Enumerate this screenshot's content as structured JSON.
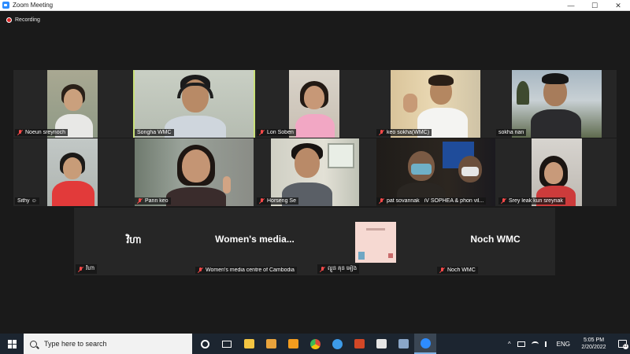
{
  "window": {
    "title": "Zoom Meeting",
    "controls": {
      "minimize": "—",
      "maximize": "☐",
      "close": "✕"
    }
  },
  "recording": {
    "label": "Recording"
  },
  "participants": [
    {
      "name": "Noeun sreynoch"
    },
    {
      "name": "Songha WMC",
      "speaking": true
    },
    {
      "name": "Lon Soben"
    },
    {
      "name": "keo sokha(WMC)"
    },
    {
      "name": "sokha nan"
    },
    {
      "name": "Sithy",
      "emoji": "☺"
    },
    {
      "name": "Pann keo"
    },
    {
      "name": "Horseng Se"
    },
    {
      "name": "pat sovannak"
    },
    {
      "name": "iV SOPHEA & phon vil..."
    },
    {
      "name": "Srey leak kun sreynak"
    },
    {
      "name": "វិហា",
      "display": "វិហា"
    },
    {
      "name": "Women's media centre of Cambodia",
      "display": "Women's  media..."
    },
    {
      "name": "ល្ងួន គុន អៀង"
    },
    {
      "name": "Noch WMC",
      "display": "Noch WMC"
    }
  ],
  "taskbar": {
    "search_placeholder": "Type here to search",
    "tray": {
      "chevron": "^",
      "language": "ENG"
    },
    "clock": {
      "time": "5:05 PM",
      "date": "2/20/2022"
    },
    "notifications": "11",
    "apps": [
      {
        "name": "task-view",
        "color": "#ffffff"
      },
      {
        "name": "file-explorer",
        "color": "#f4c542"
      },
      {
        "name": "media-player",
        "color": "#e8a33c"
      },
      {
        "name": "outlook",
        "color": "#f39c1e"
      },
      {
        "name": "chrome",
        "color": "#dd4b39"
      },
      {
        "name": "edge",
        "color": "#3d9be9"
      },
      {
        "name": "powerpoint",
        "color": "#d24726"
      },
      {
        "name": "clapper",
        "color": "#e6e6e6"
      },
      {
        "name": "network-drive",
        "color": "#8aa6c8"
      },
      {
        "name": "zoom",
        "color": "#2D8CFF"
      }
    ]
  },
  "colors": {
    "background": "#1a1a1a",
    "tile": "#262626",
    "active_speaker": "#c8e078",
    "zoom_blue": "#2D8CFF",
    "mute": "#ff4a4a"
  }
}
